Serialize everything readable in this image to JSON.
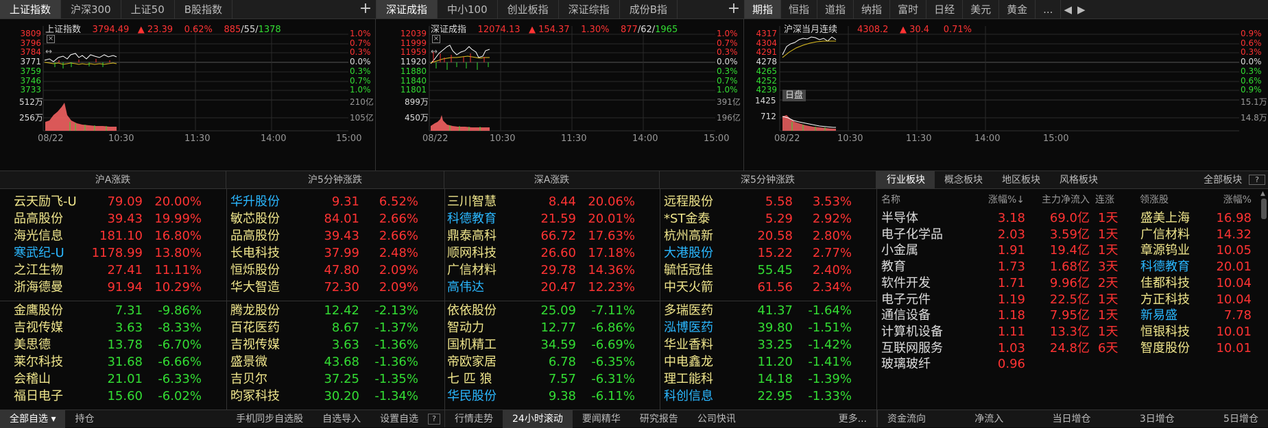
{
  "panel1": {
    "tabs": [
      "上证指数",
      "沪深300",
      "上证50",
      "B股指数"
    ],
    "title": "上证指数",
    "price": "3794.49",
    "change": "▲ 23.39",
    "pct": "0.62%",
    "adv": "885",
    "flat": "55",
    "dec": "1378",
    "yleft": [
      "3809",
      "3796",
      "3784",
      "3771",
      "3759",
      "3746",
      "3733"
    ],
    "yright": [
      "1.0%",
      "0.7%",
      "0.3%",
      "0.0%",
      "0.3%",
      "0.7%",
      "1.0%"
    ],
    "vol_left": [
      "512万",
      "256万"
    ],
    "vol_right": [
      "210亿",
      "105亿"
    ],
    "times": [
      "08/22",
      "10:30",
      "11:30",
      "14:00",
      "15:00"
    ]
  },
  "panel2": {
    "tabs": [
      "深证成指",
      "中小100",
      "创业板指",
      "深证综指",
      "成份B指"
    ],
    "title": "深证成指",
    "price": "12074.13",
    "change": "▲ 154.37",
    "pct": "1.30%",
    "adv": "877",
    "flat": "62",
    "dec": "1965",
    "yleft": [
      "12039",
      "11999",
      "11959",
      "11920",
      "11880",
      "11840",
      "11801"
    ],
    "yright": [
      "1.0%",
      "0.7%",
      "0.3%",
      "0.0%",
      "0.3%",
      "0.7%",
      "1.0%"
    ],
    "vol_left": [
      "899万",
      "450万"
    ],
    "vol_right": [
      "391亿",
      "196亿"
    ],
    "times": [
      "08/22",
      "10:30",
      "11:30",
      "14:00",
      "15:00"
    ]
  },
  "panel3": {
    "tabs": [
      "期指",
      "恒指",
      "道指",
      "纳指",
      "富时",
      "日经",
      "美元",
      "黄金",
      "..."
    ],
    "title": "沪深当月连续",
    "price": "4308.2",
    "change": "▲ 30.4",
    "pct": "0.71%",
    "yleft": [
      "4317",
      "4304",
      "4291",
      "4278",
      "4265",
      "4252",
      "4239"
    ],
    "yright": [
      "0.9%",
      "0.6%",
      "0.3%",
      "0.0%",
      "0.3%",
      "0.6%",
      "0.9%"
    ],
    "badge": "日盘",
    "vol_left": [
      "1425",
      "712"
    ],
    "vol_right": [
      "15.1万",
      "14.8万"
    ],
    "times": [
      "08/22",
      "10:30",
      "11:30",
      "14:00",
      "15:00"
    ]
  },
  "sections": {
    "sha": "沪A涨跌",
    "sh5": "沪5分钟涨跌",
    "sza": "深A涨跌",
    "sz5": "深5分钟涨跌"
  },
  "sha_up": [
    {
      "name": "云天励飞-U",
      "price": "79.09",
      "pct": "20.00%",
      "c": "yellow"
    },
    {
      "name": "品高股份",
      "price": "39.43",
      "pct": "19.99%",
      "c": "yellow"
    },
    {
      "name": "海光信息",
      "price": "181.10",
      "pct": "16.80%",
      "c": "yellow"
    },
    {
      "name": "寒武纪-U",
      "price": "1178.99",
      "pct": "13.80%",
      "c": "cyan"
    },
    {
      "name": "之江生物",
      "price": "27.41",
      "pct": "11.11%",
      "c": "yellow"
    },
    {
      "name": "浙海德曼",
      "price": "91.94",
      "pct": "10.29%",
      "c": "yellow"
    }
  ],
  "sha_dn": [
    {
      "name": "金鹰股份",
      "price": "7.31",
      "pct": "-9.86%",
      "c": "yellow"
    },
    {
      "name": "吉视传媒",
      "price": "3.63",
      "pct": "-8.33%",
      "c": "yellow"
    },
    {
      "name": "美思德",
      "price": "13.78",
      "pct": "-6.70%",
      "c": "yellow"
    },
    {
      "name": "莱尔科技",
      "price": "31.68",
      "pct": "-6.66%",
      "c": "yellow"
    },
    {
      "name": "会稽山",
      "price": "21.01",
      "pct": "-6.33%",
      "c": "yellow"
    },
    {
      "name": "福日电子",
      "price": "15.60",
      "pct": "-6.02%",
      "c": "yellow"
    }
  ],
  "sh5_up": [
    {
      "name": "华升股份",
      "price": "9.31",
      "pct": "6.52%",
      "c": "cyan"
    },
    {
      "name": "敏芯股份",
      "price": "84.01",
      "pct": "2.66%",
      "c": "yellow"
    },
    {
      "name": "品高股份",
      "price": "39.43",
      "pct": "2.66%",
      "c": "yellow"
    },
    {
      "name": "长电科技",
      "price": "37.99",
      "pct": "2.48%",
      "c": "yellow"
    },
    {
      "name": "恒烁股份",
      "price": "47.80",
      "pct": "2.09%",
      "c": "yellow"
    },
    {
      "name": "华大智造",
      "price": "72.30",
      "pct": "2.09%",
      "c": "yellow"
    }
  ],
  "sh5_dn": [
    {
      "name": "腾龙股份",
      "price": "12.42",
      "pct": "-2.13%",
      "c": "yellow"
    },
    {
      "name": "百花医药",
      "price": "8.67",
      "pct": "-1.37%",
      "c": "yellow"
    },
    {
      "name": "吉视传媒",
      "price": "3.63",
      "pct": "-1.36%",
      "c": "yellow"
    },
    {
      "name": "盛景微",
      "price": "43.68",
      "pct": "-1.36%",
      "c": "yellow"
    },
    {
      "name": "吉贝尔",
      "price": "37.25",
      "pct": "-1.35%",
      "c": "yellow"
    },
    {
      "name": "昀冢科技",
      "price": "30.20",
      "pct": "-1.34%",
      "c": "yellow"
    }
  ],
  "sza_up": [
    {
      "name": "三川智慧",
      "price": "8.44",
      "pct": "20.06%",
      "c": "yellow"
    },
    {
      "name": "科德教育",
      "price": "21.59",
      "pct": "20.01%",
      "c": "cyan"
    },
    {
      "name": "鼎泰高科",
      "price": "66.72",
      "pct": "17.63%",
      "c": "yellow"
    },
    {
      "name": "顺网科技",
      "price": "26.60",
      "pct": "17.18%",
      "c": "yellow"
    },
    {
      "name": "广信材料",
      "price": "29.78",
      "pct": "14.36%",
      "c": "yellow"
    },
    {
      "name": "高伟达",
      "price": "20.47",
      "pct": "12.23%",
      "c": "cyan"
    }
  ],
  "sza_dn": [
    {
      "name": "依依股份",
      "price": "25.09",
      "pct": "-7.11%",
      "c": "yellow"
    },
    {
      "name": "智动力",
      "price": "12.77",
      "pct": "-6.86%",
      "c": "yellow"
    },
    {
      "name": "国机精工",
      "price": "34.59",
      "pct": "-6.69%",
      "c": "yellow"
    },
    {
      "name": "帝欧家居",
      "price": "6.78",
      "pct": "-6.35%",
      "c": "yellow"
    },
    {
      "name": "七 匹 狼",
      "price": "7.57",
      "pct": "-6.31%",
      "c": "yellow"
    },
    {
      "name": "华民股份",
      "price": "9.38",
      "pct": "-6.11%",
      "c": "cyan"
    }
  ],
  "sz5_up": [
    {
      "name": "远程股份",
      "price": "5.58",
      "pct": "3.53%",
      "c": "yellow"
    },
    {
      "name": "*ST金泰",
      "price": "5.29",
      "pct": "2.92%",
      "c": "yellow"
    },
    {
      "name": "杭州高新",
      "price": "20.58",
      "pct": "2.80%",
      "c": "yellow"
    },
    {
      "name": "大港股份",
      "price": "15.22",
      "pct": "2.77%",
      "c": "cyan"
    },
    {
      "name": "毓恬冠佳",
      "price": "55.45",
      "pct": "2.40%",
      "c": "yellow",
      "pc": "green"
    },
    {
      "name": "中天火箭",
      "price": "61.56",
      "pct": "2.34%",
      "c": "yellow"
    }
  ],
  "sz5_dn": [
    {
      "name": "多瑞医药",
      "price": "41.37",
      "pct": "-1.64%",
      "c": "yellow"
    },
    {
      "name": "泓博医药",
      "price": "39.80",
      "pct": "-1.51%",
      "c": "cyan"
    },
    {
      "name": "华业香料",
      "price": "33.25",
      "pct": "-1.42%",
      "c": "yellow"
    },
    {
      "name": "中电鑫龙",
      "price": "11.20",
      "pct": "-1.41%",
      "c": "yellow"
    },
    {
      "name": "理工能科",
      "price": "14.18",
      "pct": "-1.39%",
      "c": "yellow"
    },
    {
      "name": "科创信息",
      "price": "22.95",
      "pct": "-1.33%",
      "c": "cyan"
    }
  ],
  "industry": {
    "tabs": [
      "行业板块",
      "概念板块",
      "地区板块",
      "风格板块"
    ],
    "all": "全部板块",
    "help": "?",
    "headers": [
      "名称",
      "涨幅%↓",
      "主力净流入",
      "连涨",
      "领涨股",
      "涨幅%"
    ],
    "rows": [
      {
        "name": "半导体",
        "pct": "3.18",
        "flow": "69.0亿",
        "days": "1天",
        "lead": "盛美上海",
        "lpct": "16.98",
        "lc": "yellow"
      },
      {
        "name": "电子化学品",
        "pct": "2.03",
        "flow": "3.59亿",
        "days": "1天",
        "lead": "广信材料",
        "lpct": "14.32",
        "lc": "yellow"
      },
      {
        "name": "小金属",
        "pct": "1.91",
        "flow": "19.4亿",
        "days": "1天",
        "lead": "章源钨业",
        "lpct": "10.05",
        "lc": "yellow"
      },
      {
        "name": "教育",
        "pct": "1.73",
        "flow": "1.68亿",
        "days": "3天",
        "lead": "科德教育",
        "lpct": "20.01",
        "lc": "cyan"
      },
      {
        "name": "软件开发",
        "pct": "1.71",
        "flow": "9.96亿",
        "days": "2天",
        "lead": "佳都科技",
        "lpct": "10.04",
        "lc": "yellow"
      },
      {
        "name": "电子元件",
        "pct": "1.19",
        "flow": "22.5亿",
        "days": "1天",
        "lead": "方正科技",
        "lpct": "10.04",
        "lc": "yellow"
      },
      {
        "name": "通信设备",
        "pct": "1.18",
        "flow": "7.95亿",
        "days": "1天",
        "lead": "新易盛",
        "lpct": "7.78",
        "lc": "cyan"
      },
      {
        "name": "计算机设备",
        "pct": "1.11",
        "flow": "13.3亿",
        "days": "1天",
        "lead": "恒银科技",
        "lpct": "10.01",
        "lc": "yellow"
      },
      {
        "name": "互联网服务",
        "pct": "1.03",
        "flow": "24.8亿",
        "days": "6天",
        "lead": "智度股份",
        "lpct": "10.01",
        "lc": "yellow"
      },
      {
        "name": "玻璃玻纤",
        "pct": "0.96",
        "flow": "",
        "days": "",
        "lead": "",
        "lpct": "",
        "lc": "yellow"
      }
    ]
  },
  "bottom1": {
    "tabs": [
      "全部自选 ▾",
      "持仓"
    ],
    "right": [
      "手机同步自选股",
      "自选导入",
      "设置自选"
    ],
    "help": "?"
  },
  "bottom2": {
    "tabs": [
      "行情走势",
      "24小时滚动",
      "要闻精华",
      "研究报告",
      "公司快讯"
    ],
    "more": "更多..."
  },
  "bottom3": {
    "tabs": [
      "资金流向",
      "净流入",
      "当日增仓",
      "3日增仓",
      "5日增仓"
    ]
  },
  "colors": {
    "up": "#ff3333",
    "down": "#33dd33",
    "name": "#f0e68c",
    "highlight": "#2ab7ff"
  }
}
